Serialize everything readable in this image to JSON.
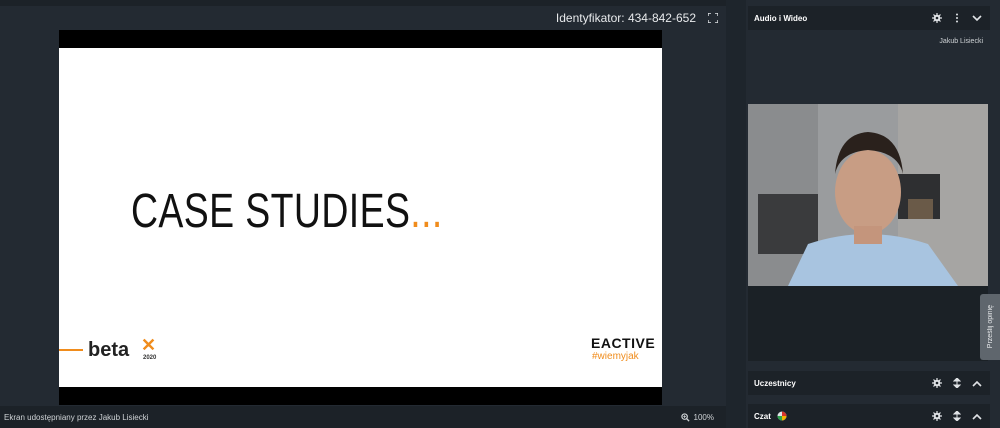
{
  "meeting": {
    "identifier_label": "Identyfikator: 434-842-652"
  },
  "slide": {
    "heading": "CASE STUDIES",
    "heading_dots": "...",
    "brand_left": "beta",
    "brand_left_mark": "✕",
    "brand_left_year": "2020",
    "brand_right": "EACTIVE",
    "brand_right_tag": "#wiemyjak"
  },
  "status": {
    "shared_by": "Ekran udostępniany przez Jakub Lisiecki",
    "zoom": "100%"
  },
  "sidebar": {
    "audio_video": {
      "title": "Audio i Wideo"
    },
    "participant_name": "Jakub Lisiecki",
    "participants": {
      "title": "Uczestnicy"
    },
    "chat": {
      "title": "Czat"
    },
    "feedback": "Prześlij opinię"
  },
  "colors": {
    "accent_orange": "#f08c1c",
    "panel_bg": "#232a32",
    "header_bg": "#1c2228"
  }
}
